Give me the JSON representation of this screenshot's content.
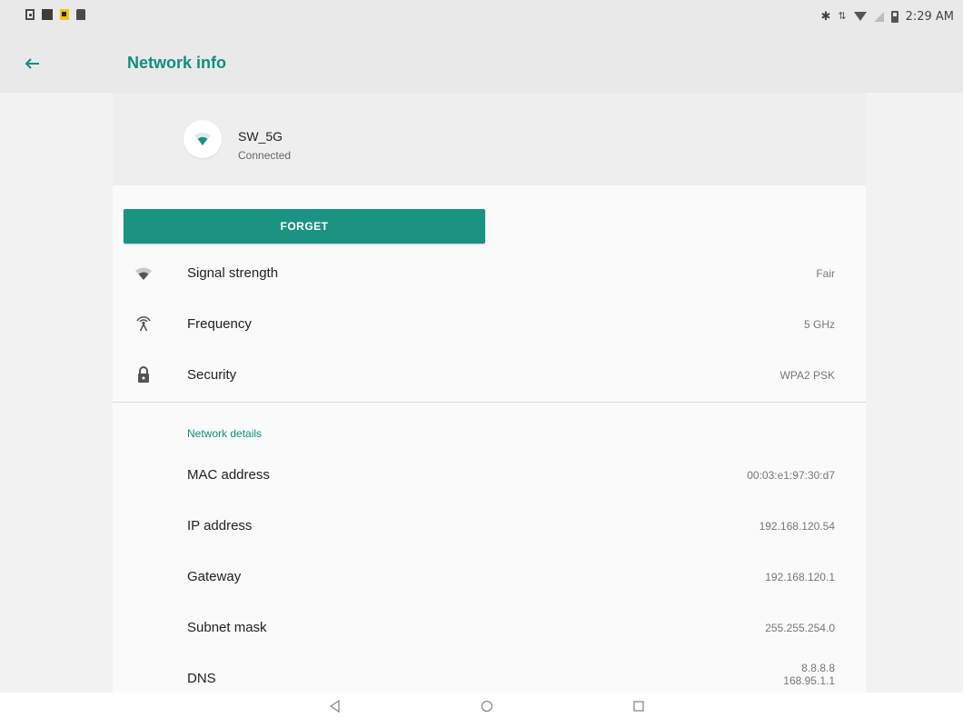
{
  "status_bar": {
    "notification_icons": [
      "image-notification-icon",
      "photo-notification-icon",
      "alert-notification-icon",
      "sd-card-icon"
    ],
    "right_icons": [
      "bluetooth-icon",
      "data-arrows-icon",
      "wifi-icon",
      "cell-signal-icon",
      "battery-icon"
    ],
    "time": "2:29 AM"
  },
  "app_bar": {
    "title": "Network info"
  },
  "network": {
    "ssid": "SW_5G",
    "status": "Connected"
  },
  "forget_button": {
    "label": "FORGET"
  },
  "info_rows": [
    {
      "label": "Signal strength",
      "value": "Fair",
      "icon": "wifi-signal-icon"
    },
    {
      "label": "Frequency",
      "value": "5 GHz",
      "icon": "antenna-icon"
    },
    {
      "label": "Security",
      "value": "WPA2 PSK",
      "icon": "lock-icon"
    }
  ],
  "details": {
    "header": "Network details",
    "rows": [
      {
        "label": "MAC address",
        "value": "00:03:e1:97:30:d7"
      },
      {
        "label": "IP address",
        "value": "192.168.120.54"
      },
      {
        "label": "Gateway",
        "value": "192.168.120.1"
      },
      {
        "label": "Subnet mask",
        "value": "255.255.254.0"
      },
      {
        "label": "DNS",
        "values": [
          "8.8.8.8",
          "168.95.1.1"
        ]
      }
    ]
  },
  "colors": {
    "accent": "#1b9383",
    "title": "#0f8f7c",
    "background": "#f2f2f2",
    "panel": "#fafafa"
  },
  "nav": [
    "back-icon",
    "home-icon",
    "recents-icon"
  ]
}
